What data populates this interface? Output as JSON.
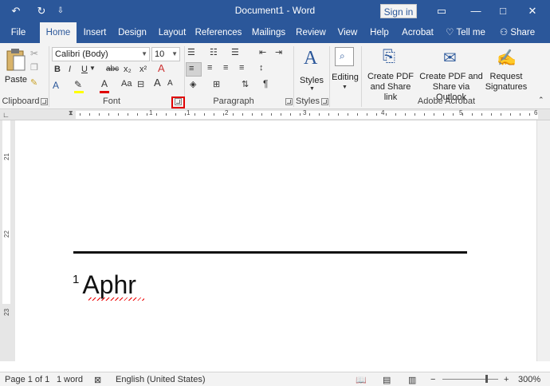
{
  "titlebar": {
    "title": "Document1  -  Word",
    "signin": "Sign in",
    "undo_glyph": "↶",
    "redo_glyph": "↻",
    "customize_glyph": "⇩",
    "minimize_glyph": "—",
    "restore_glyph": "□",
    "close_glyph": "✕",
    "ribbon_display_glyph": "▭",
    "bg_color": "#2b579a"
  },
  "tabs": [
    {
      "label": "File"
    },
    {
      "label": "Home"
    },
    {
      "label": "Insert"
    },
    {
      "label": "Design"
    },
    {
      "label": "Layout"
    },
    {
      "label": "References"
    },
    {
      "label": "Mailings"
    },
    {
      "label": "Review"
    },
    {
      "label": "View"
    },
    {
      "label": "Help"
    },
    {
      "label": "Acrobat"
    },
    {
      "label": "Tell me"
    },
    {
      "label": "Share"
    }
  ],
  "ribbon": {
    "clipboard": {
      "label": "Clipboard",
      "paste": "Paste"
    },
    "font": {
      "label": "Font",
      "font_name": "Calibri (Body)",
      "font_size": "10",
      "bold": "B",
      "italic": "I",
      "underline": "U",
      "strike": "abc",
      "subscript": "x₂",
      "superscript": "x²",
      "grow": "A",
      "shrink": "A",
      "change_case": "Aa",
      "font_color": "A",
      "clear": "A"
    },
    "paragraph": {
      "label": "Paragraph",
      "pilcrow": "¶"
    },
    "styles": {
      "label": "Styles",
      "button": "Styles"
    },
    "editing": {
      "button": "Editing"
    },
    "acrobat": {
      "label": "Adobe Acrobat",
      "create_pdf_1": "Create PDF",
      "create_pdf_2": "and Share link",
      "outlook_1": "Create PDF and",
      "outlook_2": "Share via Outlook",
      "request_1": "Request",
      "request_2": "Signatures"
    }
  },
  "ruler": {
    "numbers": [
      "1",
      "1",
      "2",
      "3",
      "4",
      "5",
      "6"
    ],
    "vertical_numbers": [
      "21",
      "22",
      "23"
    ]
  },
  "document": {
    "footnote_number": "1",
    "footnote_text": "Aphr"
  },
  "status": {
    "page": "Page 1 of 1",
    "words": "1 word",
    "language": "English (United States)",
    "zoom": "300%",
    "zoom_minus": "−",
    "zoom_plus": "+"
  },
  "colors": {
    "accent": "#2b579a",
    "highlight_box": "#e00000",
    "font_color_bar": "#e00000",
    "text_highlight_bar": "#ffff00"
  }
}
